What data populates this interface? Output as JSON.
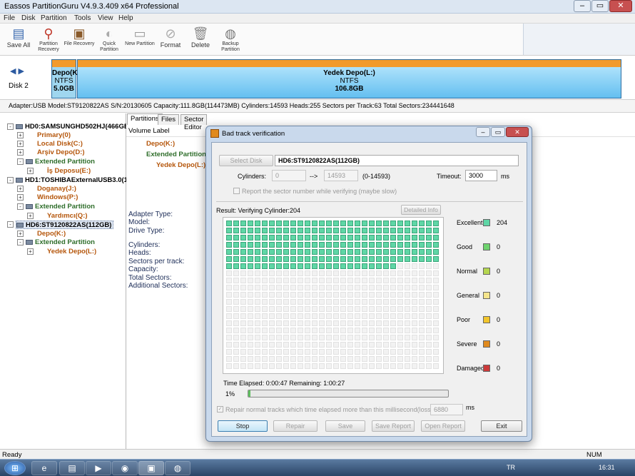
{
  "window": {
    "title": "Eassos PartitionGuru V4.9.3.409 x64 Professional"
  },
  "menu": [
    "File",
    "Disk",
    "Partition",
    "Tools",
    "View",
    "Help"
  ],
  "toolbar": [
    {
      "label": "Save All",
      "icon": "save-icon"
    },
    {
      "label": "Partition Recovery",
      "icon": "magnifier-icon"
    },
    {
      "label": "File Recovery",
      "icon": "file-recovery-icon"
    },
    {
      "label": "Quick Partition",
      "icon": "quick-partition-icon"
    },
    {
      "label": "New Partition",
      "icon": "new-partition-icon"
    },
    {
      "label": "Format",
      "icon": "format-icon"
    },
    {
      "label": "Delete",
      "icon": "trash-icon"
    },
    {
      "label": "Backup Partition",
      "icon": "backup-icon"
    }
  ],
  "diskmap": {
    "disk_label": "Disk 2",
    "partitions": [
      {
        "name": "Depo(K:",
        "fs": "NTFS",
        "size": "5.0GB"
      },
      {
        "name": "Yedek Depo(L:)",
        "fs": "NTFS",
        "size": "106.8GB"
      }
    ]
  },
  "infoline": "Adapter:USB  Model:ST9120822AS  S/N:20130605  Capacity:111.8GB(114473MB)  Cylinders:14593  Heads:255  Sectors per Track:63  Total Sectors:234441648",
  "tree": [
    {
      "label": "HD0:SAMSUNGHD502HJ(466GB",
      "style": "b",
      "plus": "-"
    },
    {
      "label": "Primary(0)",
      "style": "orange",
      "plus": "+"
    },
    {
      "label": "Local Disk(C:)",
      "style": "orange",
      "plus": "+"
    },
    {
      "label": "Arşiv Depo(D:)",
      "style": "orange",
      "plus": "+"
    },
    {
      "label": "Extended Partition",
      "style": "green",
      "plus": "-"
    },
    {
      "label": "İş Deposu(E:)",
      "style": "orange",
      "plus": "+"
    },
    {
      "label": "HD1:TOSHIBAExternalUSB3.0(1",
      "style": "b",
      "plus": "-"
    },
    {
      "label": "Doganay(J:)",
      "style": "orange",
      "plus": "+"
    },
    {
      "label": "Windows(P:)",
      "style": "orange",
      "plus": "+"
    },
    {
      "label": "Extended Partition",
      "style": "green",
      "plus": "-"
    },
    {
      "label": "Yardımcı(Q:)",
      "style": "orange",
      "plus": "+"
    },
    {
      "label": "HD6:ST9120822AS(112GB)",
      "style": "b",
      "plus": "-"
    },
    {
      "label": "Depo(K:)",
      "style": "orange",
      "plus": "+"
    },
    {
      "label": "Extended Partition",
      "style": "green",
      "plus": "-"
    },
    {
      "label": "Yedek Depo(L:)",
      "style": "orange",
      "plus": "+"
    }
  ],
  "tabs": [
    "Partitions",
    "Files",
    "Sector Editor"
  ],
  "volume_header": "Volume Label",
  "volumes": [
    "Depo(K:)",
    "Extended Partition",
    "Yedek Depo(L:)"
  ],
  "details_labels": [
    "Adapter Type:",
    "Model:",
    "Drive Type:",
    "Cylinders:",
    "Heads:",
    "Sectors per track:",
    "Capacity:",
    "Total Sectors:",
    "Additional Sectors:"
  ],
  "status": {
    "left": "Ready",
    "right": "NUM"
  },
  "taskbar": {
    "lang": "TR",
    "time": "16:31"
  },
  "dialog": {
    "title": "Bad track verification",
    "select_disk_label": "Select Disk",
    "disk_name": "HD6:ST9120822AS(112GB)",
    "cylinders_label": "Cylinders:",
    "cyl_from": "0",
    "arrow": "-->",
    "cyl_to": "14593",
    "cyl_range": "(0-14593)",
    "timeout_label": "Timeout:",
    "timeout_value": "3000",
    "timeout_unit": "ms",
    "report_sector_label": "Report the sector number while verifying (maybe slow)",
    "result_text": "Result:  Verifying Cylinder:204",
    "detailed_info": "Detailed Info",
    "verified_cells": 204,
    "legend": [
      {
        "name": "Excellent",
        "color": "#5fd6a6",
        "count": "204"
      },
      {
        "name": "Good",
        "color": "#6fd46f",
        "count": "0"
      },
      {
        "name": "Normal",
        "color": "#b5d64f",
        "count": "0"
      },
      {
        "name": "General",
        "color": "#f5e58c",
        "count": "0"
      },
      {
        "name": "Poor",
        "color": "#f2c52b",
        "count": "0"
      },
      {
        "name": "Severe",
        "color": "#e08a1e",
        "count": "0"
      },
      {
        "name": "Damaged",
        "color": "#cc3a3a",
        "count": "0"
      }
    ],
    "time_elapsed": "Time Elapsed:  0:00:47  Remaining:  1:00:27",
    "progress_text": "1%",
    "progress": 0.01,
    "repair_label": "Repair normal tracks which time elapsed more than this millisecond(lossless):",
    "repair_value": "6880",
    "repair_unit": "ms",
    "buttons": {
      "stop": "Stop",
      "repair": "Repair",
      "save": "Save",
      "save_report": "Save Report",
      "open_report": "Open Report",
      "exit": "Exit"
    }
  }
}
